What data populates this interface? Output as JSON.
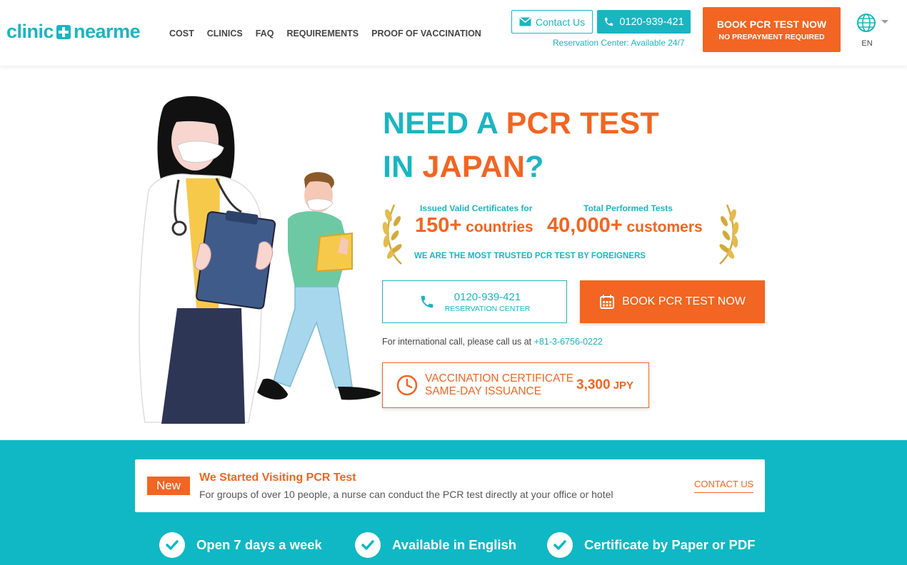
{
  "brand": {
    "logo_left": "clinic",
    "logo_right": "nearme"
  },
  "nav": {
    "items": [
      "COST",
      "CLINICS",
      "FAQ",
      "REQUIREMENTS",
      "PROOF OF VACCINATION"
    ]
  },
  "header": {
    "contact_label": "Contact Us",
    "phone_label": "0120-939-421",
    "reservation_note": "Reservation Center: Available 24/7",
    "book_label": "BOOK PCR TEST NOW",
    "book_sub": "NO PREPAYMENT REQUIRED",
    "lang_code": "EN"
  },
  "hero": {
    "title_need": "NEED A ",
    "title_pcr": "PCR TEST",
    "title_in": "IN ",
    "title_japan": "JAPAN",
    "title_q": "?"
  },
  "stats": {
    "left_label": "Issued Valid Certificates for",
    "left_num": "150+",
    "left_unit": " countries",
    "right_label": "Total Performed Tests",
    "right_num": "40,000+",
    "right_unit": " customers",
    "trusted": "WE ARE THE MOST TRUSTED PCR TEST BY FOREIGNERS"
  },
  "cta": {
    "phone": "0120-939-421",
    "phone_sub": "RESERVATION CENTER",
    "book": "BOOK PCR TEST NOW",
    "intl_text": "For international call, please call us at ",
    "intl_number": "+81-3-6756-0222"
  },
  "vaccination": {
    "line1": "VACCINATION CERTIFICATE",
    "line2": "SAME-DAY ISSUANCE",
    "price": "3,300",
    "currency": " JPY"
  },
  "notice": {
    "badge": "New",
    "title": "We Started Visiting PCR Test",
    "desc": "For groups of over 10 people, a nurse can conduct the PCR test directly at your office or hotel",
    "cta": "CONTACT US"
  },
  "features": [
    "Open 7 days a week",
    "Available in English",
    "Certificate by Paper or PDF"
  ],
  "colors": {
    "teal": "#1bb5c1",
    "orange": "#f26522",
    "band": "#0fb8c4"
  }
}
